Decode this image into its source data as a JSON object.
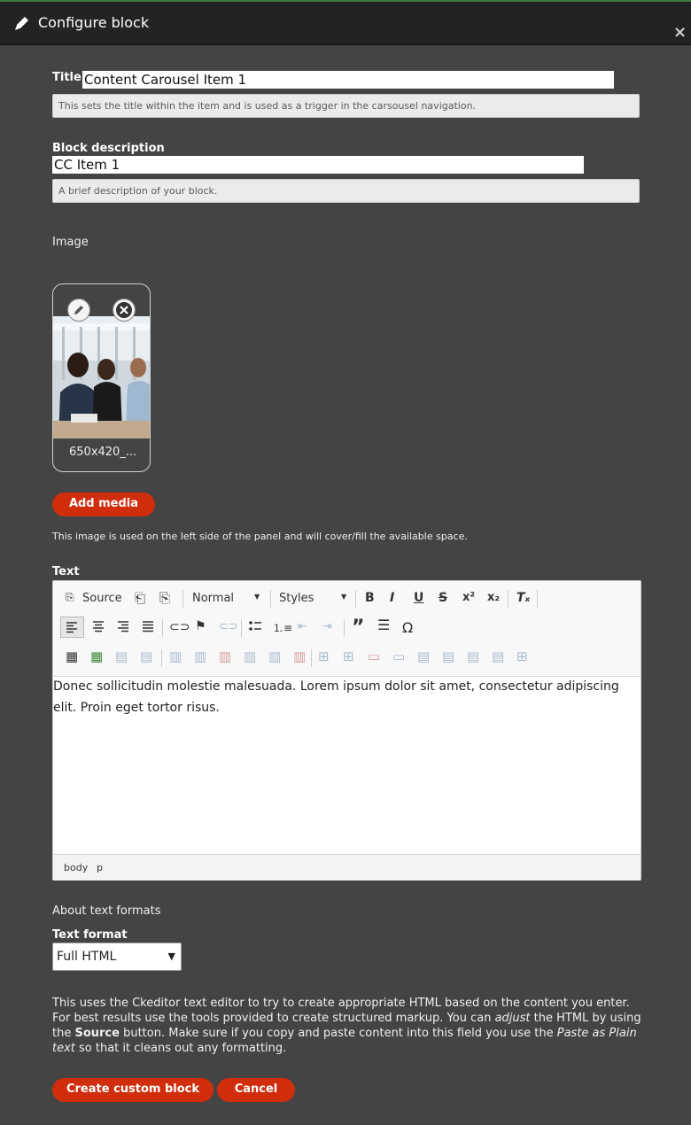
{
  "dialog": {
    "title": "Configure block",
    "close_glyph": "×"
  },
  "form": {
    "title_label": "Title",
    "title_value": "Content Carousel Item 1",
    "title_help": "This sets the title within the item and is used as a trigger in the carsousel navigation.",
    "desc_label": "Block description",
    "desc_value": "CC Item 1",
    "desc_help": "A brief description of your block.",
    "image_label": "Image",
    "image_filename": "650x420_...",
    "add_media": "Add media",
    "image_help": "This image is used on the left side of the panel and will cover/fill the available space.",
    "text_label": "Text",
    "about_formats": "About text formats",
    "format_label": "Text format",
    "format_value": "Full HTML",
    "format_help_1": "This uses the Ckeditor text editor to try to create appropriate HTML based on the content you enter. For best results use the tools provided to create structured markup. You can ",
    "format_help_adjust": "adjust",
    "format_help_2": " the HTML by using the ",
    "format_help_source": "Source",
    "format_help_3": " button. Make sure if you copy and paste content into this field you use the ",
    "format_help_paste": "Paste as Plain text",
    "format_help_4": " so that it cleans out any formatting.",
    "create_btn": "Create custom block",
    "cancel_btn": "Cancel"
  },
  "editor": {
    "source": "Source",
    "format_combo": "Normal",
    "styles_combo": "Styles",
    "content": "Donec sollicitudin molestie malesuada. Lorem ipsum dolor sit amet, consectetur adipiscing elit. Proin eget tortor risus.",
    "path_body": "body",
    "path_p": "p"
  },
  "colors": {
    "accent": "#d02d0c",
    "background": "#444444",
    "titlebar": "#232323"
  }
}
